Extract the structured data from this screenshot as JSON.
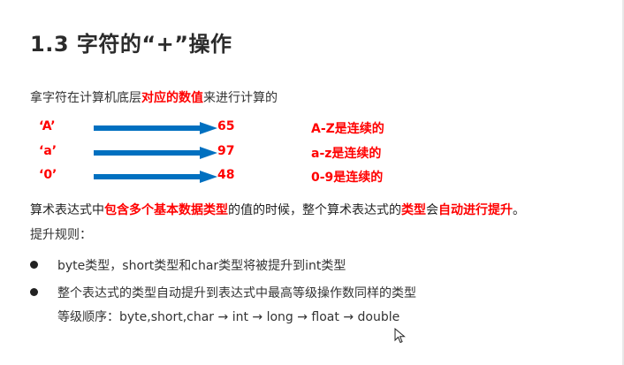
{
  "title": "1.3 字符的“+”操作",
  "intro": {
    "prefix": "拿字符在计算机底层",
    "highlight": "对应的数值",
    "suffix": "来进行计算的"
  },
  "mappings": [
    {
      "char": "‘A’",
      "code": "65",
      "note": "A-Z是连续的"
    },
    {
      "char": "‘a’",
      "code": "97",
      "note": "a-z是连续的"
    },
    {
      "char": "‘0’",
      "code": "48",
      "note": "0-9是连续的"
    }
  ],
  "arrow_color": "#0070c0",
  "highlight_color": "#ff0000",
  "promotion": {
    "p1": "算术表达式中",
    "h1": "包含多个基本数据类型",
    "p2": "的值的时候，整个算术表达式的",
    "h2": "类型",
    "p3": "会",
    "h3": "自动进行提升",
    "p4": "。"
  },
  "rules_label": "提升规则：",
  "bullets": [
    "byte类型，short类型和char类型将被提升到int类型",
    "整个表达式的类型自动提升到表达式中最高等级操作数同样的类型"
  ],
  "order_text": "等级顺序：byte,short,char → int → long → float → double",
  "cursor_icon": "mouse-pointer-icon"
}
